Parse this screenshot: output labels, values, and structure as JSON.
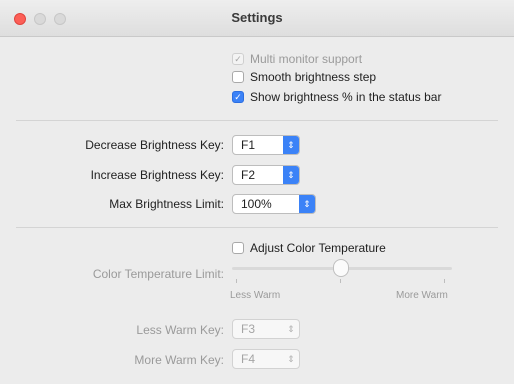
{
  "window": {
    "title": "Settings"
  },
  "options": {
    "multi_monitor": {
      "label": "Multi monitor support",
      "checked": true,
      "enabled": false
    },
    "smooth_step": {
      "label": "Smooth brightness step",
      "checked": false,
      "enabled": true
    },
    "show_percent": {
      "label": "Show brightness % in the status bar",
      "checked": true,
      "enabled": true
    }
  },
  "keys": {
    "decrease": {
      "label": "Decrease Brightness Key:",
      "value": "F1"
    },
    "increase": {
      "label": "Increase Brightness Key:",
      "value": "F2"
    },
    "max_limit": {
      "label": "Max Brightness Limit:",
      "value": "100%"
    }
  },
  "color_temp": {
    "adjust": {
      "label": "Adjust Color Temperature",
      "checked": false
    },
    "limit_label": "Color Temperature Limit:",
    "slider_value": 0.5,
    "min_label": "Less Warm",
    "max_label": "More Warm",
    "less_warm_key": {
      "label": "Less Warm Key:",
      "value": "F3"
    },
    "more_warm_key": {
      "label": "More Warm Key:",
      "value": "F4"
    }
  },
  "colors": {
    "accent": "#3b82f7",
    "close": "#fc5f57",
    "window_bg": "#ececec"
  }
}
